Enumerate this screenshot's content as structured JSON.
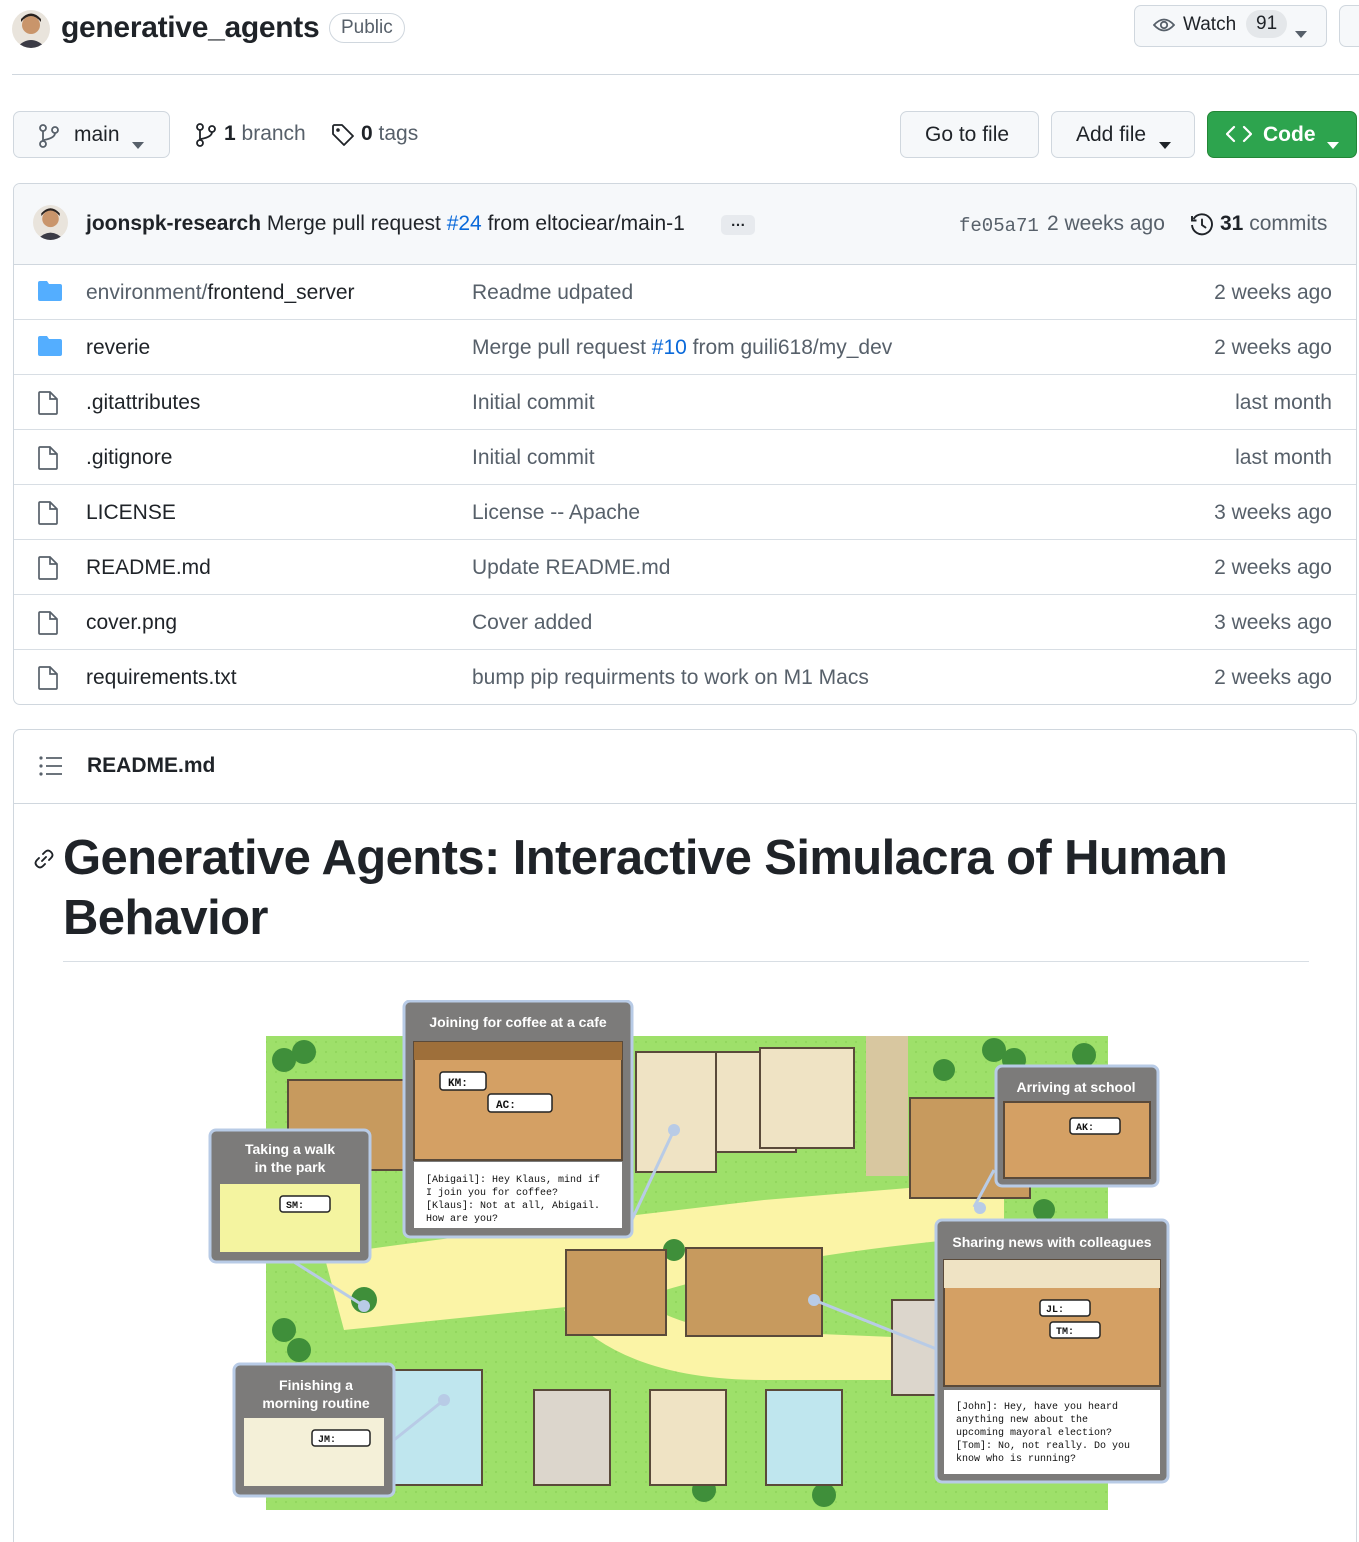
{
  "repo": {
    "name": "generative_agents",
    "visibility": "Public",
    "watch_label": "Watch",
    "watch_count": "91"
  },
  "toolbar": {
    "branch": "main",
    "branches_count": "1",
    "branches_label": "branch",
    "tags_count": "0",
    "tags_label": "tags",
    "go_to_file": "Go to file",
    "add_file": "Add file",
    "code": "Code"
  },
  "latest_commit": {
    "author": "joonspk-research",
    "message_prefix": "Merge pull request",
    "pr_link": "#24",
    "message_suffix": "from eltociear/main-1",
    "ellipsis": "…",
    "sha": "fe05a71",
    "time": "2 weeks ago",
    "commits_count": "31",
    "commits_label": "commits"
  },
  "files": [
    {
      "type": "folder",
      "dir": "environment/",
      "name": "frontend_server",
      "msg": "Readme udpated",
      "age": "2 weeks ago"
    },
    {
      "type": "folder",
      "name": "reverie",
      "msg_prefix": "Merge pull request",
      "msg_link": "#10",
      "msg_suffix": "from guili618/my_dev",
      "age": "2 weeks ago"
    },
    {
      "type": "file",
      "name": ".gitattributes",
      "msg": "Initial commit",
      "age": "last month"
    },
    {
      "type": "file",
      "name": ".gitignore",
      "msg": "Initial commit",
      "age": "last month"
    },
    {
      "type": "file",
      "name": "LICENSE",
      "msg": "License -- Apache",
      "age": "3 weeks ago"
    },
    {
      "type": "file",
      "name": "README.md",
      "msg": "Update README.md",
      "age": "2 weeks ago"
    },
    {
      "type": "file",
      "name": "cover.png",
      "msg": "Cover added",
      "age": "3 weeks ago"
    },
    {
      "type": "file",
      "name": "requirements.txt",
      "msg": "bump pip requirments to work on M1 Macs",
      "age": "2 weeks ago"
    }
  ],
  "readme": {
    "filename": "README.md",
    "title": "Generative Agents: Interactive Simulacra of Human Behavior"
  },
  "cover_image": {
    "panels": {
      "cafe": "Joining for coffee at a cafe",
      "school": "Arriving at school",
      "walk_line1": "Taking a walk",
      "walk_line2": "in the park",
      "news": "Sharing news with colleagues",
      "routine_line1": "Finishing a",
      "routine_line2": "morning routine"
    },
    "speech": {
      "km": "KM:",
      "ac": "AC:",
      "ak": "AK:",
      "sm": "SM:",
      "jl": "JL:",
      "tm": "TM:",
      "jm": "JM:"
    },
    "cafe_dialog": [
      "[Abigail]: Hey Klaus, mind if",
      "I join you for coffee?",
      "[Klaus]: Not at all, Abigail.",
      "How are you?"
    ],
    "news_dialog": [
      "[John]: Hey, have you heard",
      "anything new about the",
      "upcoming mayoral election?",
      "[Tom]: No, not really. Do you",
      "know who is running?"
    ]
  },
  "colors": {
    "accent_link": "#0969da",
    "code_button": "#2da44e",
    "folder_icon": "#54aeff",
    "muted_text": "#57606a",
    "border": "#d0d7de"
  }
}
